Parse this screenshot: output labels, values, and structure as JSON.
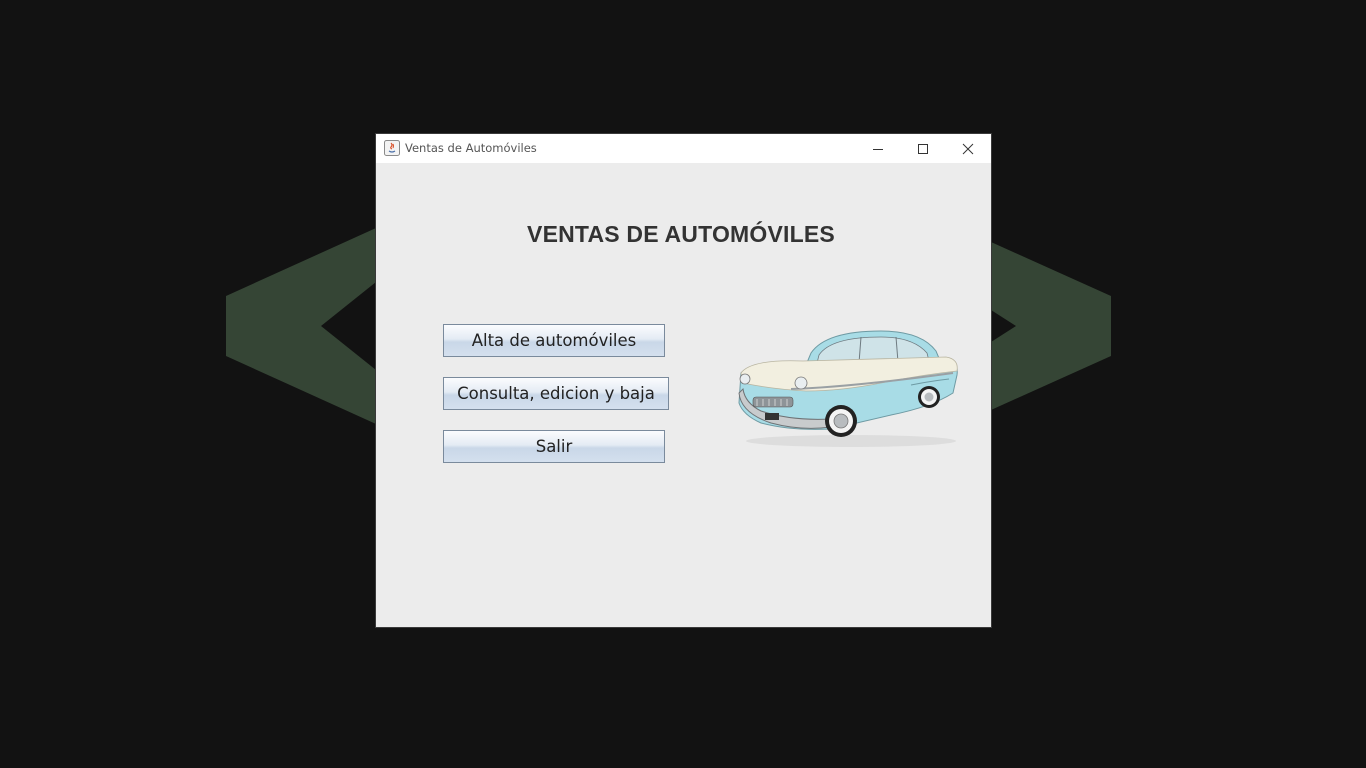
{
  "window": {
    "title": "Ventas de Automóviles",
    "controls": {
      "minimize_icon": "minimize-icon",
      "maximize_icon": "maximize-icon",
      "close_icon": "close-icon"
    }
  },
  "main": {
    "heading": "VENTAS DE AUTOMÓVILES",
    "buttons": [
      {
        "label": "Alta de automóviles"
      },
      {
        "label": "Consulta, edicion y baja"
      },
      {
        "label": "Salir"
      }
    ],
    "image": "classic-car-image"
  },
  "colors": {
    "desktop_background": "#121212",
    "logo_green": "#354535",
    "window_background": "#ececec",
    "titlebar": "#ffffff",
    "car_blue": "#a8dce6",
    "car_cream": "#f2efe0"
  }
}
